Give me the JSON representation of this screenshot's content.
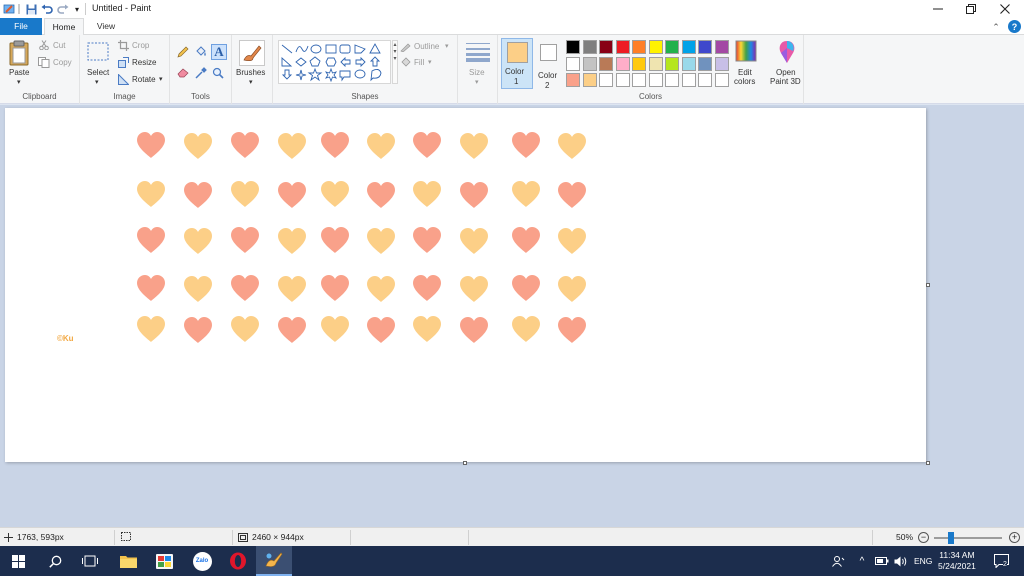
{
  "window": {
    "title": "Untitled - Paint",
    "controls": [
      "minimize",
      "restore",
      "close"
    ]
  },
  "tabs": [
    {
      "label": "File",
      "active": false
    },
    {
      "label": "Home",
      "active": true
    },
    {
      "label": "View",
      "active": false
    }
  ],
  "ribbon": {
    "clipboard": {
      "paste": "Paste",
      "cut": "Cut",
      "copy": "Copy",
      "group": "Clipboard"
    },
    "image": {
      "select": "Select",
      "crop": "Crop",
      "resize": "Resize",
      "rotate": "Rotate",
      "group": "Image"
    },
    "tools": {
      "group": "Tools"
    },
    "brushes": {
      "label": "Brushes"
    },
    "shapes": {
      "outline": "Outline",
      "fill": "Fill",
      "group": "Shapes"
    },
    "size": {
      "label": "Size"
    },
    "color1": {
      "label": "Color",
      "num": "1",
      "value": "#fccf87"
    },
    "color2": {
      "label": "Color",
      "num": "2",
      "value": "#ffffff"
    },
    "colors": {
      "group": "Colors",
      "edit_line1": "Edit",
      "edit_line2": "colors",
      "palette_row1": [
        "#000000",
        "#7f7f7f",
        "#880015",
        "#ed1c24",
        "#ff7f27",
        "#fff200",
        "#22b14c",
        "#00a2e8",
        "#3f48cc",
        "#a349a4"
      ],
      "palette_row2": [
        "#ffffff",
        "#c3c3c3",
        "#b97a57",
        "#ffaec9",
        "#ffc90e",
        "#efe4b0",
        "#b5e61d",
        "#99d9ea",
        "#7092be",
        "#c8bfe7"
      ],
      "palette_row3": [
        "#f9a18a",
        "#fccf87",
        "#ffffff",
        "#ffffff",
        "#ffffff",
        "#ffffff",
        "#ffffff",
        "#ffffff",
        "#ffffff",
        "#ffffff"
      ]
    },
    "paint3d": {
      "line1": "Open",
      "line2": "Paint 3D"
    }
  },
  "canvas": {
    "watermark": "©Ku",
    "heart_colors": {
      "coral": "#f9a18a",
      "peach": "#fccf87"
    },
    "heart_rows": [
      [
        "coral",
        "peach",
        "coral",
        "peach",
        "coral",
        "peach",
        "coral",
        "peach",
        "coral",
        "peach"
      ],
      [
        "peach",
        "coral",
        "peach",
        "coral",
        "peach",
        "coral",
        "peach",
        "coral",
        "peach",
        "coral"
      ],
      [
        "coral",
        "peach",
        "coral",
        "peach",
        "coral",
        "peach",
        "coral",
        "peach",
        "coral",
        "peach"
      ],
      [
        "coral",
        "peach",
        "coral",
        "peach",
        "coral",
        "peach",
        "coral",
        "peach",
        "coral",
        "peach"
      ],
      [
        "peach",
        "coral",
        "peach",
        "coral",
        "peach",
        "coral",
        "peach",
        "coral",
        "peach",
        "coral"
      ]
    ]
  },
  "status": {
    "cursor": "1763, 593px",
    "image_size": "2460 × 944px",
    "zoom": "50%",
    "zoom_fraction": 0.25
  },
  "taskbar": {
    "apps": [
      "start-icon",
      "search-icon",
      "task-view-icon",
      "file-explorer-icon",
      "photos-icon",
      "zalo-icon",
      "opera-icon",
      "paint-icon"
    ],
    "zalo_label": "Zalo",
    "lang": "ENG",
    "time": "11:34 AM",
    "date": "5/24/2021",
    "notifications": "2"
  }
}
